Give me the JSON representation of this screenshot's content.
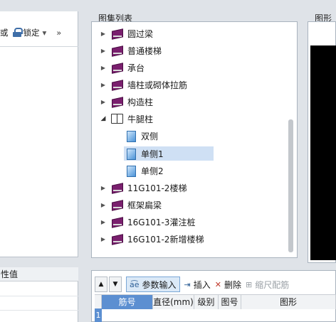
{
  "left_toolbar": {
    "cut_text": "或",
    "lock_label": "锁定",
    "more": "»"
  },
  "properties": {
    "header": "性值"
  },
  "atlas_panel": {
    "title": "图集列表",
    "items": [
      {
        "label": "圆过梁",
        "type": "book",
        "expanded": false
      },
      {
        "label": "普通楼梯",
        "type": "book",
        "expanded": false
      },
      {
        "label": "承台",
        "type": "book",
        "expanded": false
      },
      {
        "label": "墙柱或砌体拉筋",
        "type": "book",
        "expanded": false
      },
      {
        "label": "构造柱",
        "type": "book",
        "expanded": false
      },
      {
        "label": "牛腿柱",
        "type": "book-open",
        "expanded": true
      },
      {
        "label": "双侧",
        "type": "doc"
      },
      {
        "label": "单侧1",
        "type": "doc",
        "selected": true
      },
      {
        "label": "单侧2",
        "type": "doc"
      },
      {
        "label": "11G101-2楼梯",
        "type": "book",
        "expanded": false
      },
      {
        "label": "框架扁梁",
        "type": "book",
        "expanded": false
      },
      {
        "label": "16G101-3灌注桩",
        "type": "book",
        "expanded": false
      },
      {
        "label": "16G101-2新增楼梯",
        "type": "book",
        "expanded": false
      }
    ]
  },
  "preview_panel": {
    "title": "图形显"
  },
  "rebar_toolbar": {
    "param_input": "参数输入",
    "insert": "插入",
    "delete": "删除",
    "scale_rebar": "缩尺配筋"
  },
  "rebar_grid": {
    "columns": [
      "筋号",
      "直径(mm)",
      "级别",
      "图号",
      "图形"
    ],
    "first_row_number": "1"
  }
}
